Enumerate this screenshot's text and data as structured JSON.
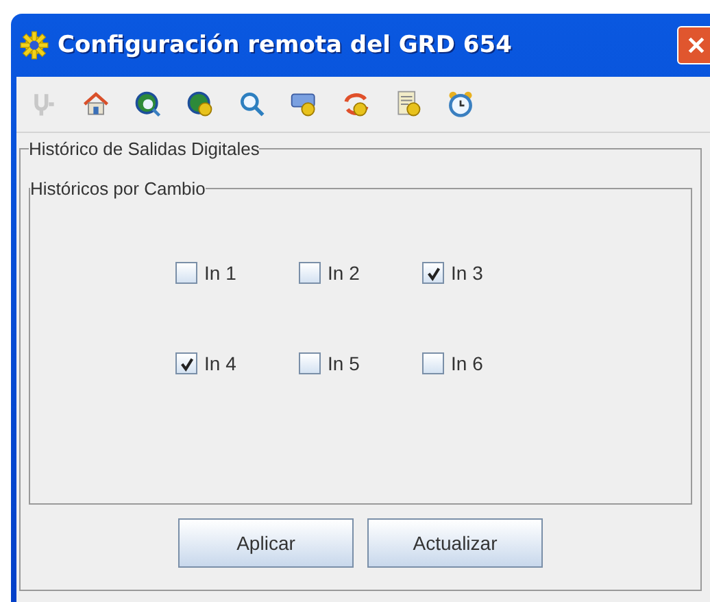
{
  "window": {
    "title": "Configuración remota del GRD 654"
  },
  "toolbar": [
    {
      "kind": "plug",
      "disabled": true
    },
    {
      "kind": "home",
      "disabled": false
    },
    {
      "kind": "globe-search",
      "disabled": false
    },
    {
      "kind": "globe-gear",
      "disabled": false
    },
    {
      "kind": "search",
      "disabled": false
    },
    {
      "kind": "screen-gear",
      "disabled": false
    },
    {
      "kind": "sync-gear",
      "disabled": false
    },
    {
      "kind": "doc-gear",
      "disabled": false
    },
    {
      "kind": "clock",
      "disabled": false
    }
  ],
  "panel": {
    "title": "Histórico de Salidas Digitales",
    "group": {
      "title": "Históricos por Cambio",
      "checkboxes": [
        {
          "label": "In 1",
          "checked": false
        },
        {
          "label": "In 2",
          "checked": false
        },
        {
          "label": "In 3",
          "checked": true
        },
        {
          "label": "In 4",
          "checked": true
        },
        {
          "label": "In 5",
          "checked": false
        },
        {
          "label": "In 6",
          "checked": false
        }
      ]
    }
  },
  "buttons": [
    "Aplicar",
    "Actualizar"
  ]
}
